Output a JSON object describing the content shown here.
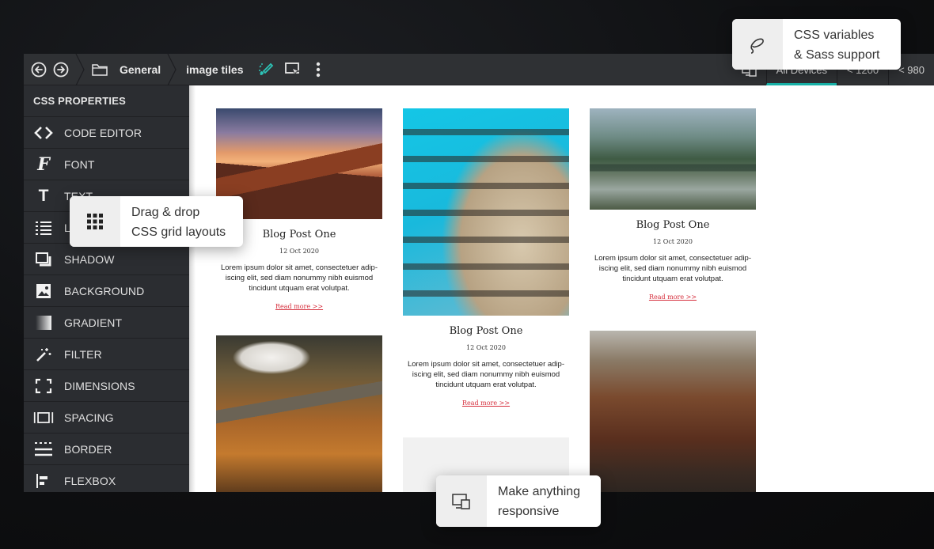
{
  "toolbar": {
    "breadcrumb": [
      "General",
      "image tiles"
    ],
    "breakpoints": [
      "All Devices",
      "< 1200",
      "< 980"
    ],
    "accent": "#18b3a9"
  },
  "sidebar": {
    "header": "CSS PROPERTIES",
    "items": [
      {
        "label": "CODE EDITOR",
        "icon": "code-brackets-icon"
      },
      {
        "label": "FONT",
        "icon": "font-icon"
      },
      {
        "label": "TEXT",
        "icon": "text-icon"
      },
      {
        "label": "LIST",
        "icon": "list-icon"
      },
      {
        "label": "SHADOW",
        "icon": "shadow-icon"
      },
      {
        "label": "BACKGROUND",
        "icon": "image-icon"
      },
      {
        "label": "GRADIENT",
        "icon": "gradient-icon"
      },
      {
        "label": "FILTER",
        "icon": "magic-wand-icon"
      },
      {
        "label": "DIMENSIONS",
        "icon": "dimensions-icon"
      },
      {
        "label": "SPACING",
        "icon": "spacing-icon"
      },
      {
        "label": "BORDER",
        "icon": "border-icon"
      },
      {
        "label": "FLEXBOX",
        "icon": "flexbox-icon"
      }
    ]
  },
  "cards": [
    {
      "title": "Blog Post One",
      "date": "12 Oct 2020",
      "text": "Lorem ipsum dolor sit amet, consectetuer adip-iscing elit, sed diam nonummy nibh euismod tincidunt utquam erat volutpat.",
      "link": "Read more >>"
    },
    {
      "title": "Blog Post One",
      "date": "12 Oct 2020",
      "text": "Lorem ipsum dolor sit amet, consectetuer adip-iscing elit, sed diam nonummy nibh euismod tincidunt utquam erat volutpat.",
      "link": "Read more >>"
    },
    {
      "title": "Blog Post One",
      "date": "12 Oct 2020",
      "text": "Lorem ipsum dolor sit amet, consectetuer adip-iscing elit, sed diam nonummy nibh euismod tincidunt utquam erat volutpat.",
      "link": "Read more >>"
    }
  ],
  "tooltips": {
    "variables": "CSS variables\n& Sass support",
    "grid": "Drag & drop\nCSS grid layouts",
    "responsive": "Make anything\nresponsive"
  },
  "colors": {
    "link_red": "#d6303e",
    "panel_dark": "#2b2d31"
  }
}
